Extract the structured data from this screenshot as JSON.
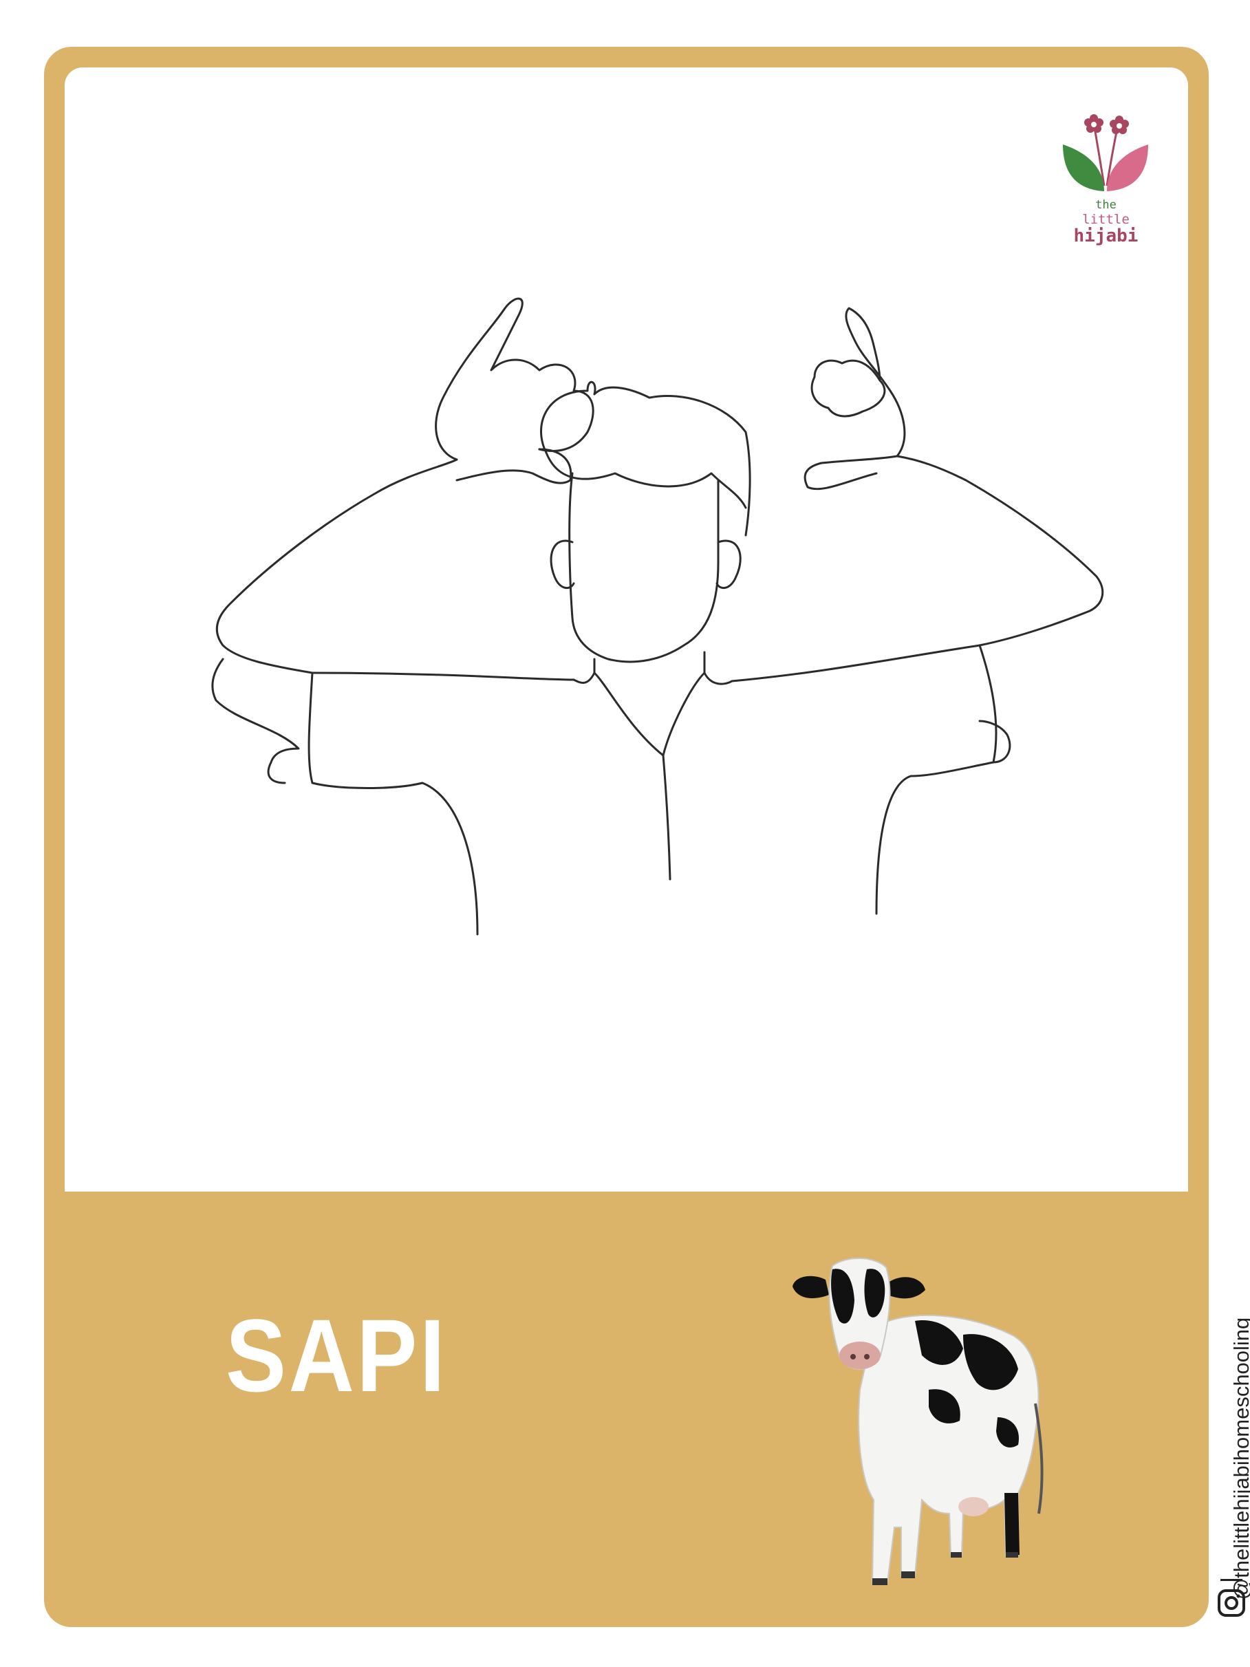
{
  "card": {
    "word": "SAPI",
    "image_subject": "cow",
    "accent_color": "#dcb469"
  },
  "logo": {
    "line1": "the",
    "line2": "little",
    "line3": "hijabi",
    "icon": "flower-sprout-icon",
    "colors": {
      "green": "#3f8b3f",
      "pink": "#d86b8a",
      "flower": "#a8465f"
    }
  },
  "social": {
    "icon": "instagram-icon",
    "handle": "@thelittlehijabihomeschooling"
  },
  "illustration": {
    "subject": "person-signing-cow-icon"
  }
}
